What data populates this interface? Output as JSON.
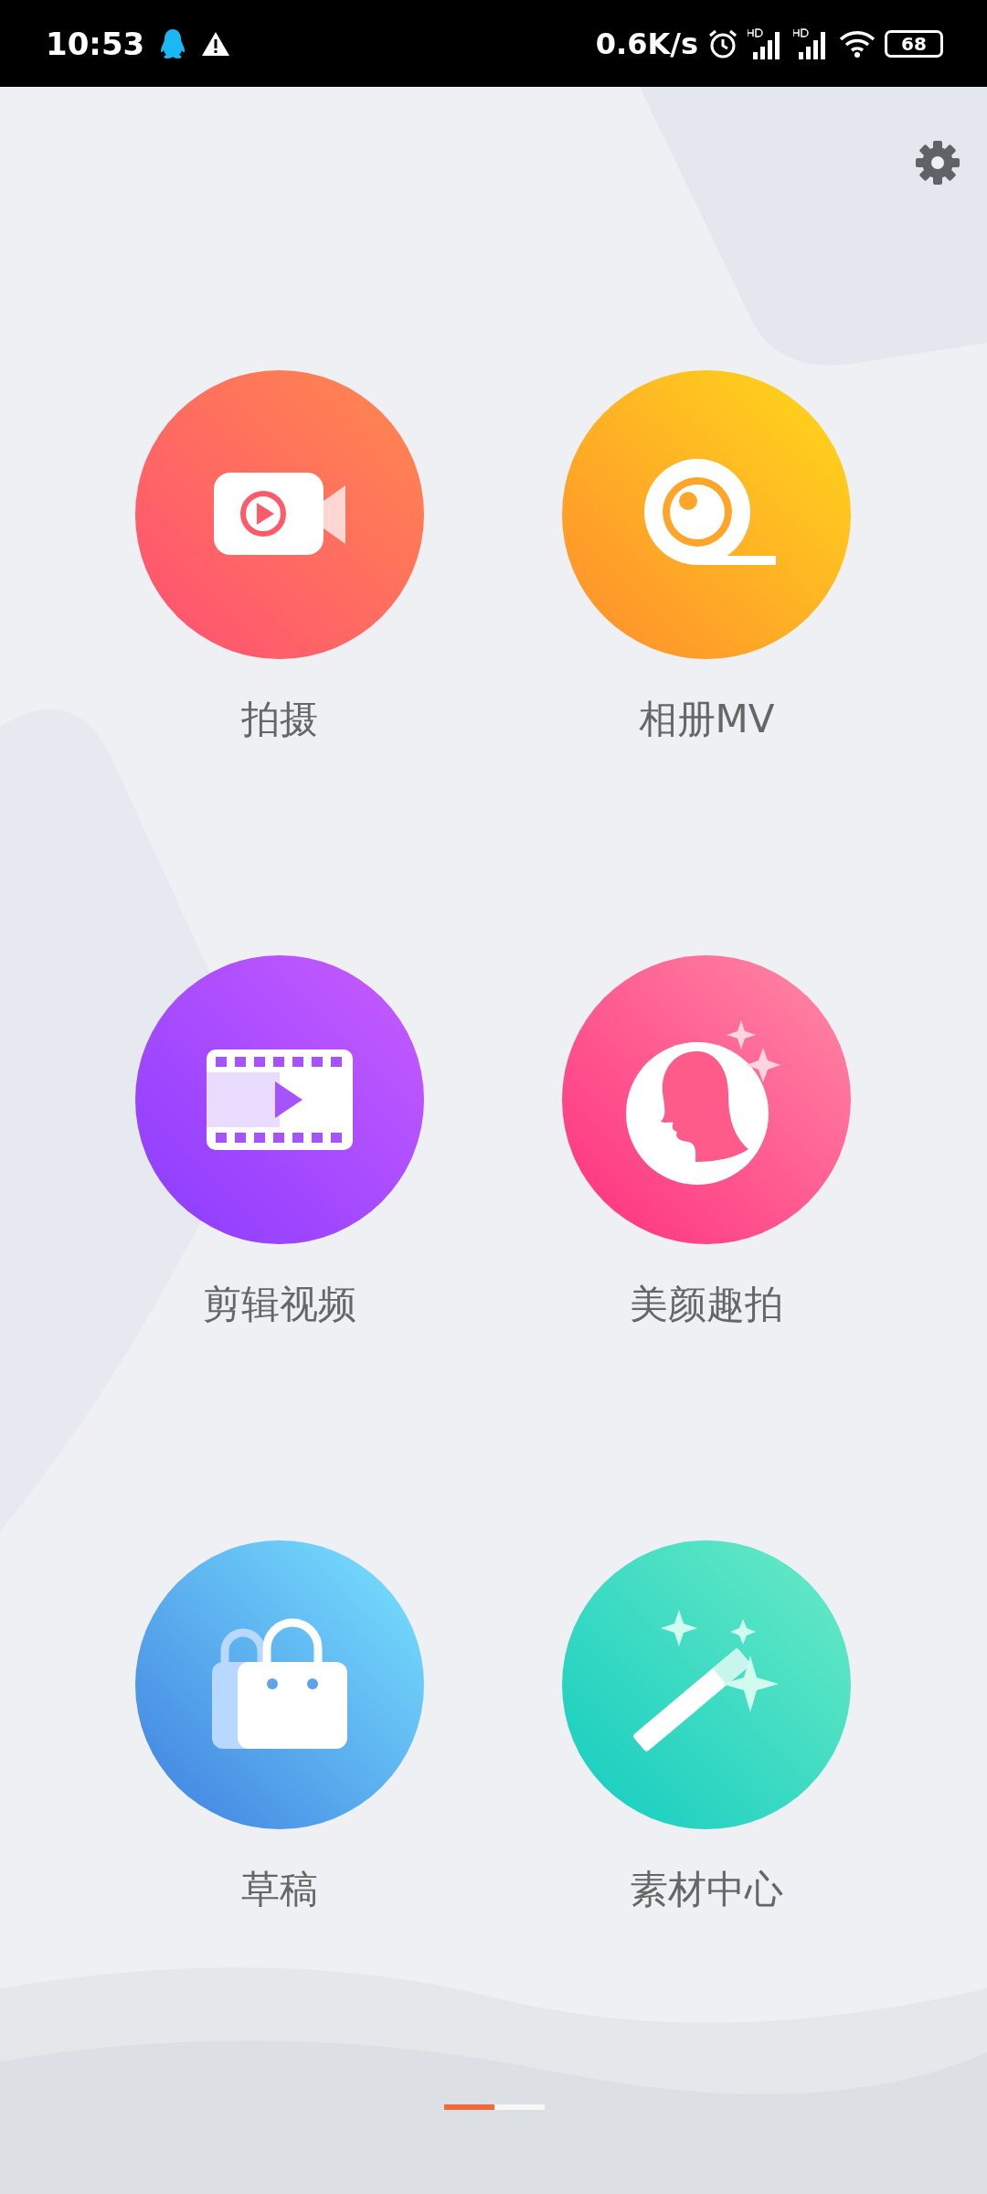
{
  "status_bar": {
    "time": "10:53",
    "net_speed": "0.6K/s",
    "battery": "68"
  },
  "tiles": [
    {
      "label": "拍摄",
      "kind": "camera"
    },
    {
      "label": "相册MV",
      "kind": "album"
    },
    {
      "label": "剪辑视频",
      "kind": "film"
    },
    {
      "label": "美颜趣拍",
      "kind": "beauty"
    },
    {
      "label": "草稿",
      "kind": "bag"
    },
    {
      "label": "素材中心",
      "kind": "magic"
    }
  ],
  "pages": [
    {
      "selected": true
    },
    {
      "selected": false
    }
  ]
}
